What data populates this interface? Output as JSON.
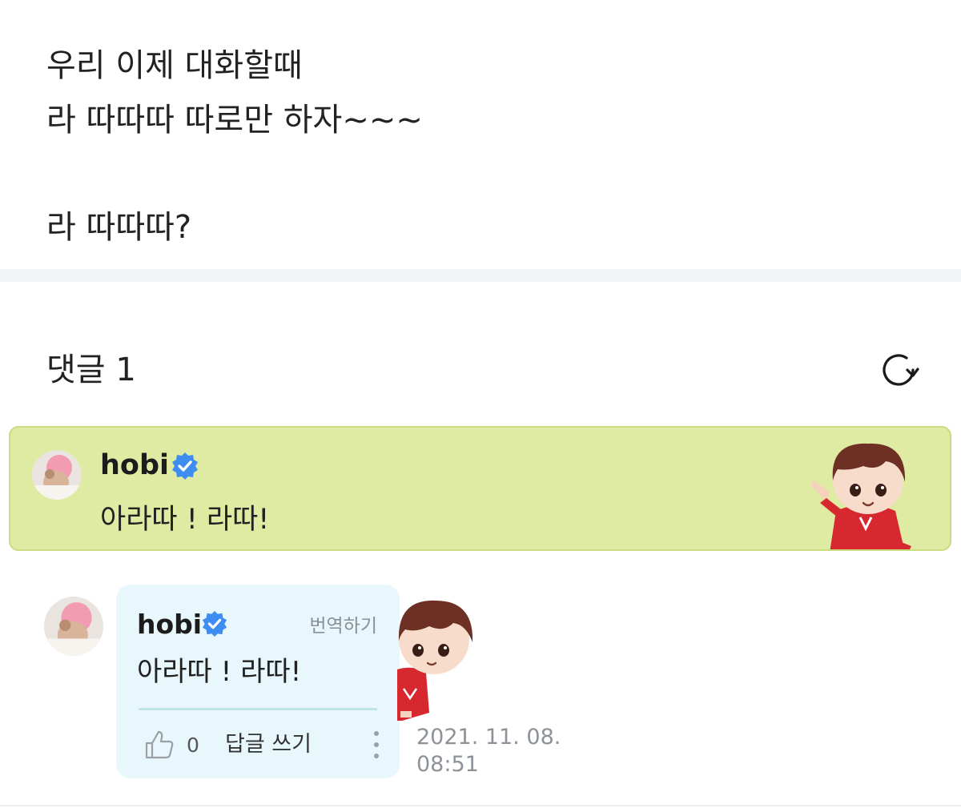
{
  "post": {
    "lines": [
      "우리 이제 대화할때",
      "라 따따따 따로만 하자~~~",
      "라 따따따?"
    ]
  },
  "comments": {
    "title": "댓글 1",
    "refresh_icon": "refresh-icon"
  },
  "pinned_comment": {
    "author": "hobi",
    "verified_icon": "verified-badge-icon",
    "text": "아라따 ! 라따!",
    "background": "#dfeaa3",
    "sticker": "character-sticker"
  },
  "reply_comment": {
    "author": "hobi",
    "verified_icon": "verified-badge-icon",
    "translate_label": "번역하기",
    "text": "아라따 ! 라따!",
    "like_icon": "thumbs-up-icon",
    "like_count": "0",
    "reply_label": "답글 쓰기",
    "more_icon": "more-vertical-icon",
    "timestamp_date": "2021. 11. 08.",
    "timestamp_time": "08:51",
    "background": "#e8f7fb"
  },
  "colors": {
    "verified_blue": "#3d8ef0",
    "highlight_green": "#dfeaa3"
  }
}
